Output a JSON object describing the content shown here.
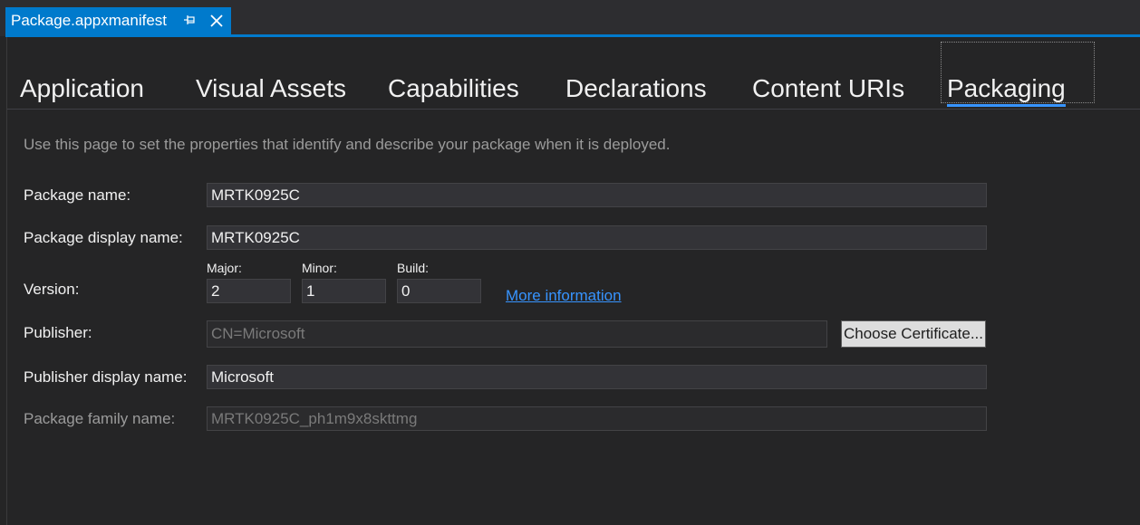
{
  "document_tab": {
    "title": "Package.appxmanifest",
    "pin_icon": "pin-icon",
    "close_icon": "close-icon"
  },
  "tabs": [
    {
      "label": "Application"
    },
    {
      "label": "Visual Assets"
    },
    {
      "label": "Capabilities"
    },
    {
      "label": "Declarations"
    },
    {
      "label": "Content URIs"
    },
    {
      "label": "Packaging",
      "active": true
    }
  ],
  "description": "Use this page to set the properties that identify and describe your package when it is deployed.",
  "form": {
    "package_name": {
      "label": "Package name:",
      "value": "MRTK0925C"
    },
    "package_display_name": {
      "label": "Package display name:",
      "value": "MRTK0925C"
    },
    "version": {
      "label": "Version:",
      "major": {
        "label": "Major:",
        "value": "2"
      },
      "minor": {
        "label": "Minor:",
        "value": "1"
      },
      "build": {
        "label": "Build:",
        "value": "0"
      },
      "more_info_link": "More information"
    },
    "publisher": {
      "label": "Publisher:",
      "value": "CN=Microsoft",
      "button_label": "Choose Certificate..."
    },
    "publisher_display_name": {
      "label": "Publisher display name:",
      "value": "Microsoft"
    },
    "package_family_name": {
      "label": "Package family name:",
      "value": "MRTK0925C_ph1m9x8skttmg"
    }
  },
  "colors": {
    "accent": "#007acc",
    "background": "#252526",
    "link": "#3794ff"
  }
}
